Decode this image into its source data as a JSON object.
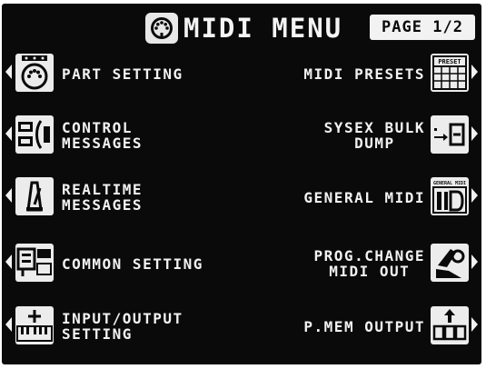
{
  "header": {
    "title": "MIDI MENU",
    "page_label": "PAGE 1/2"
  },
  "left_items": [
    {
      "lines": [
        "PART SETTING"
      ],
      "icon": "keyboard-connector-icon"
    },
    {
      "lines": [
        "CONTROL",
        "MESSAGES"
      ],
      "icon": "control-panel-icon"
    },
    {
      "lines": [
        "REALTIME",
        "MESSAGES"
      ],
      "icon": "metronome-icon"
    },
    {
      "lines": [
        "COMMON SETTING"
      ],
      "icon": "module-setting-icon"
    },
    {
      "lines": [
        "INPUT/OUTPUT",
        "SETTING"
      ],
      "icon": "keyboard-io-icon"
    }
  ],
  "right_items": [
    {
      "lines": [
        "MIDI PRESETS"
      ],
      "icon": "preset-grid-icon",
      "icon_text": "PRESET"
    },
    {
      "lines": [
        "SYSEX BULK",
        "DUMP"
      ],
      "icon": "bulk-dump-icon"
    },
    {
      "lines": [
        "GENERAL MIDI"
      ],
      "icon": "general-midi-icon",
      "icon_text": "GENERAL MIDI"
    },
    {
      "lines": [
        "PROG.CHANGE",
        "MIDI OUT"
      ],
      "icon": "hand-icon"
    },
    {
      "lines": [
        "P.MEM OUTPUT"
      ],
      "icon": "memory-output-icon"
    }
  ],
  "colors": {
    "screen_bg": "#0a0a0a",
    "text": "#f2f2f2"
  }
}
